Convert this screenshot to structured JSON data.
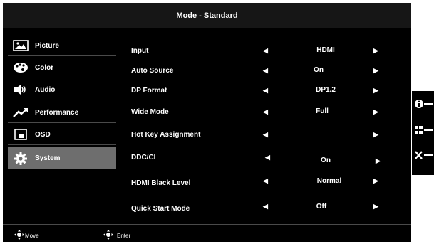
{
  "title": "Mode - Standard",
  "sidebar": [
    {
      "label": "Picture",
      "icon": "picture-icon"
    },
    {
      "label": "Color",
      "icon": "palette-icon"
    },
    {
      "label": "Audio",
      "icon": "speaker-icon"
    },
    {
      "label": "Performance",
      "icon": "trend-up-icon"
    },
    {
      "label": "OSD",
      "icon": "osd-window-icon"
    },
    {
      "label": "System",
      "icon": "gear-icon"
    }
  ],
  "settings": [
    {
      "label": "Input",
      "value": "HDMI"
    },
    {
      "label": "Auto Source",
      "value": "On"
    },
    {
      "label": "DP Format",
      "value": "DP1.2"
    },
    {
      "label": "Wide Mode",
      "value": "Full"
    },
    {
      "label": "Hot Key Assignment",
      "value": ""
    },
    {
      "label": "DDC/CI",
      "value": "On"
    },
    {
      "label": "HDMI Black Level",
      "value": "Normal"
    },
    {
      "label": "Quick Start Mode",
      "value": "Off"
    }
  ],
  "footer": {
    "move_label": "Move",
    "enter_label": "Enter"
  },
  "hotkeys": [
    {
      "icon": "info-icon"
    },
    {
      "icon": "grid-icon"
    },
    {
      "icon": "close-icon"
    }
  ],
  "colors": {
    "background": "#000000",
    "title_bar": "#161616",
    "selected": "#6e6e6e",
    "text": "#ffffff"
  }
}
